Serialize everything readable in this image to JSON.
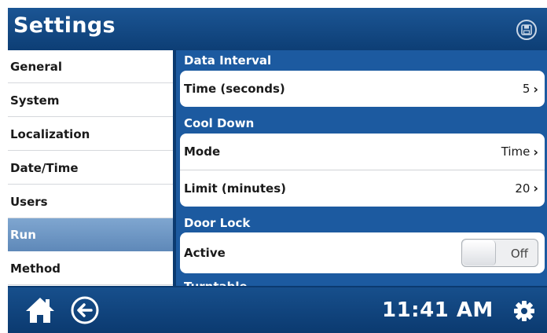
{
  "header": {
    "title": "Settings",
    "save_icon": "save-icon"
  },
  "sidebar": {
    "items": [
      {
        "label": "General"
      },
      {
        "label": "System"
      },
      {
        "label": "Localization"
      },
      {
        "label": "Date/Time"
      },
      {
        "label": "Users"
      },
      {
        "label": "Run",
        "active": true
      },
      {
        "label": "Method"
      }
    ]
  },
  "main": {
    "sections": [
      {
        "title": "Data Interval",
        "rows": [
          {
            "label": "Time (seconds)",
            "value": "5"
          }
        ]
      },
      {
        "title": "Cool Down",
        "rows": [
          {
            "label": "Mode",
            "value": "Time"
          },
          {
            "label": "Limit (minutes)",
            "value": "20"
          }
        ]
      },
      {
        "title": "Door Lock",
        "rows": [
          {
            "label": "Active",
            "toggle": "Off"
          }
        ]
      },
      {
        "title": "Turntable"
      }
    ]
  },
  "footer": {
    "time": "11:41 AM"
  },
  "colors": {
    "header": "#0d3e75",
    "panel": "#1c5aa0",
    "active_item": "#6f97c6"
  }
}
